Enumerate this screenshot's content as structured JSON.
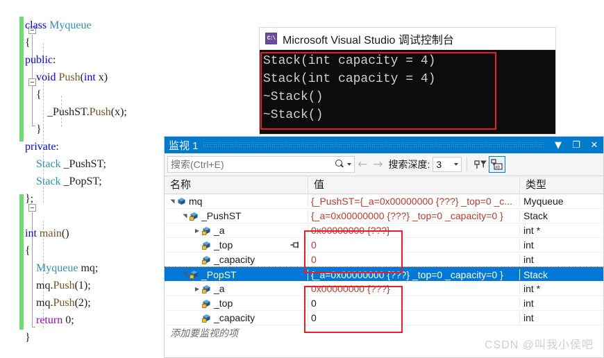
{
  "editor": {
    "lines": [
      {
        "indent": 0,
        "tokens": [
          {
            "t": "class ",
            "c": "kw"
          },
          {
            "t": "Myqueue",
            "c": "typ"
          }
        ]
      },
      {
        "indent": 0,
        "tokens": [
          {
            "t": "{",
            "c": "pl"
          }
        ]
      },
      {
        "indent": 0,
        "tokens": [
          {
            "t": "public",
            "c": "kw"
          },
          {
            "t": ":",
            "c": "pl"
          }
        ]
      },
      {
        "indent": 1,
        "tokens": [
          {
            "t": "void ",
            "c": "kw"
          },
          {
            "t": "Push",
            "c": "fn"
          },
          {
            "t": "(",
            "c": "pl"
          },
          {
            "t": "int",
            "c": "kw"
          },
          {
            "t": " x)",
            "c": "pl"
          }
        ]
      },
      {
        "indent": 1,
        "tokens": [
          {
            "t": "{",
            "c": "pl"
          }
        ]
      },
      {
        "indent": 2,
        "tokens": [
          {
            "t": "_PushST.",
            "c": "pl"
          },
          {
            "t": "Push",
            "c": "fn"
          },
          {
            "t": "(x);",
            "c": "pl"
          }
        ]
      },
      {
        "indent": 1,
        "tokens": [
          {
            "t": "}",
            "c": "pl"
          }
        ]
      },
      {
        "indent": 0,
        "tokens": [
          {
            "t": "private",
            "c": "kw"
          },
          {
            "t": ":",
            "c": "pl"
          }
        ]
      },
      {
        "indent": 1,
        "tokens": [
          {
            "t": "Stack",
            "c": "typ"
          },
          {
            "t": " _PushST;",
            "c": "pl"
          }
        ]
      },
      {
        "indent": 1,
        "tokens": [
          {
            "t": "Stack",
            "c": "typ"
          },
          {
            "t": " _PopST;",
            "c": "pl"
          }
        ]
      },
      {
        "indent": 0,
        "tokens": [
          {
            "t": "};",
            "c": "pl"
          }
        ]
      },
      {
        "indent": 0,
        "tokens": []
      },
      {
        "indent": 0,
        "tokens": [
          {
            "t": "int ",
            "c": "kw"
          },
          {
            "t": "main",
            "c": "fn"
          },
          {
            "t": "()",
            "c": "pl"
          }
        ]
      },
      {
        "indent": 0,
        "tokens": [
          {
            "t": "{",
            "c": "pl"
          }
        ]
      },
      {
        "indent": 1,
        "tokens": [
          {
            "t": "Myqueue",
            "c": "typ"
          },
          {
            "t": " mq;",
            "c": "pl"
          }
        ]
      },
      {
        "indent": 1,
        "tokens": [
          {
            "t": "mq.",
            "c": "pl"
          },
          {
            "t": "Push",
            "c": "fn"
          },
          {
            "t": "(1);",
            "c": "pl"
          }
        ]
      },
      {
        "indent": 1,
        "tokens": [
          {
            "t": "mq.",
            "c": "pl"
          },
          {
            "t": "Push",
            "c": "fn"
          },
          {
            "t": "(2);",
            "c": "pl"
          }
        ]
      },
      {
        "indent": 1,
        "tokens": [
          {
            "t": "return",
            "c": "ctl"
          },
          {
            "t": " 0;",
            "c": "pl"
          }
        ]
      },
      {
        "indent": 0,
        "tokens": [
          {
            "t": "}",
            "c": "pl"
          }
        ]
      }
    ]
  },
  "console": {
    "title": "Microsoft Visual Studio 调试控制台",
    "icon": "console-app-icon",
    "output": "Stack(int capacity = 4)\nStack(int capacity = 4)\n~Stack()\n~Stack()"
  },
  "watch": {
    "title": "监视 1",
    "window_buttons": [
      {
        "name": "dropdown-button",
        "glyph": "▼"
      },
      {
        "name": "maximize-button",
        "glyph": "❐"
      },
      {
        "name": "close-button",
        "glyph": "✕"
      }
    ],
    "toolbar": {
      "search_placeholder": "搜索(Ctrl+E)",
      "search_value": "",
      "search_icon": "search-icon",
      "search_dropdown_icon": "chevron-down-icon",
      "back_icon": "arrow-left-icon",
      "forward_icon": "arrow-right-icon",
      "depth_label": "搜索深度:",
      "depth_value": "3",
      "pin_filter_icon": "pin-filter-icon",
      "hex_display_icon": "string-view-icon"
    },
    "columns": [
      "名称",
      "值",
      "类型"
    ],
    "rows": [
      {
        "depth": 0,
        "expander": "expanded",
        "icon": "class-icon",
        "name": "mq",
        "value": "{_PushST={_a=0x00000000 {???} _top=0 _c...",
        "type": "Myqueue",
        "value_red": true,
        "selected": false,
        "pin": false
      },
      {
        "depth": 1,
        "expander": "expanded",
        "icon": "private-field-icon",
        "name": "_PushST",
        "value": "{_a=0x00000000 {???} _top=0 _capacity=0 }",
        "type": "Stack",
        "value_red": true,
        "selected": false,
        "pin": false
      },
      {
        "depth": 2,
        "expander": "collapsed",
        "icon": "private-field-icon",
        "name": "_a",
        "value": "0x00000000 {???}",
        "type": "int *",
        "value_red": true,
        "selected": false,
        "pin": false
      },
      {
        "depth": 2,
        "expander": "none",
        "icon": "private-field-icon",
        "name": "_top",
        "value": "0",
        "type": "int",
        "value_red": true,
        "selected": false,
        "pin": true
      },
      {
        "depth": 2,
        "expander": "none",
        "icon": "private-field-icon",
        "name": "_capacity",
        "value": "0",
        "type": "int",
        "value_red": true,
        "selected": false,
        "pin": false
      },
      {
        "depth": 1,
        "expander": "expanded",
        "icon": "private-field-icon",
        "name": "_PopST",
        "value": "{_a=0x00000000 {???} _top=0 _capacity=0 }",
        "type": "Stack",
        "value_red": true,
        "selected": true,
        "pin": false
      },
      {
        "depth": 2,
        "expander": "collapsed",
        "icon": "private-field-icon",
        "name": "_a",
        "value": "0x00000000 {???}",
        "type": "int *",
        "value_red": true,
        "selected": false,
        "pin": false
      },
      {
        "depth": 2,
        "expander": "none",
        "icon": "private-field-icon",
        "name": "_top",
        "value": "0",
        "type": "int",
        "value_red": false,
        "selected": false,
        "pin": false
      },
      {
        "depth": 2,
        "expander": "none",
        "icon": "private-field-icon",
        "name": "_capacity",
        "value": "0",
        "type": "int",
        "value_red": false,
        "selected": false,
        "pin": false
      }
    ],
    "add_watch_placeholder": "添加要监视的项"
  },
  "watermark": "CSDN @叫我小侯吧",
  "colors": {
    "accent": "#007acc",
    "selection": "#0078d7",
    "annotation_red": "#ee1c25",
    "value_red": "#c0392b",
    "keyword_blue": "#0000ff",
    "type_teal": "#2b91af",
    "function_brown": "#74531f",
    "control_purple": "#8f08c4",
    "change_bar_green": "#6fdc6f",
    "console_bg": "#0c0c0c"
  }
}
